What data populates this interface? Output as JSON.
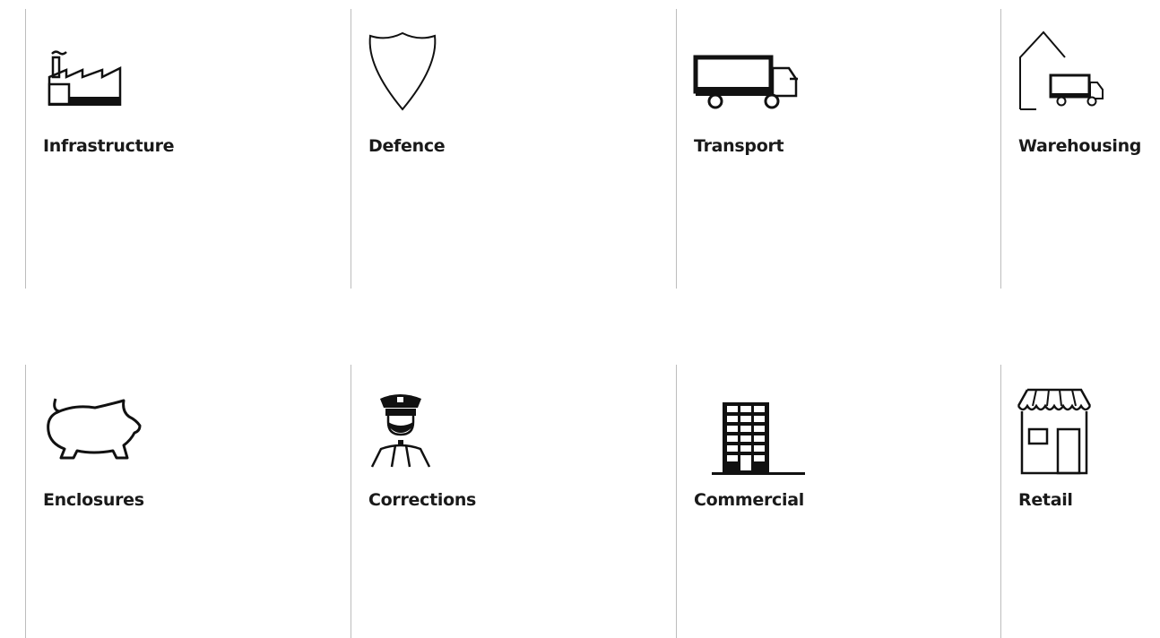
{
  "sectors": {
    "items": [
      {
        "label": "Infrastructure",
        "icon": "factory-icon"
      },
      {
        "label": "Defence",
        "icon": "shield-icon"
      },
      {
        "label": "Transport",
        "icon": "truck-icon"
      },
      {
        "label": "Warehousing",
        "icon": "warehouse-icon"
      },
      {
        "label": "Enclosures",
        "icon": "pig-icon"
      },
      {
        "label": "Corrections",
        "icon": "officer-icon"
      },
      {
        "label": "Commercial",
        "icon": "office-building-icon"
      },
      {
        "label": "Retail",
        "icon": "storefront-icon"
      }
    ]
  },
  "colors": {
    "icon": "#111111",
    "text": "#1a1a1a",
    "divider": "#bdbdbd",
    "background": "#ffffff"
  }
}
